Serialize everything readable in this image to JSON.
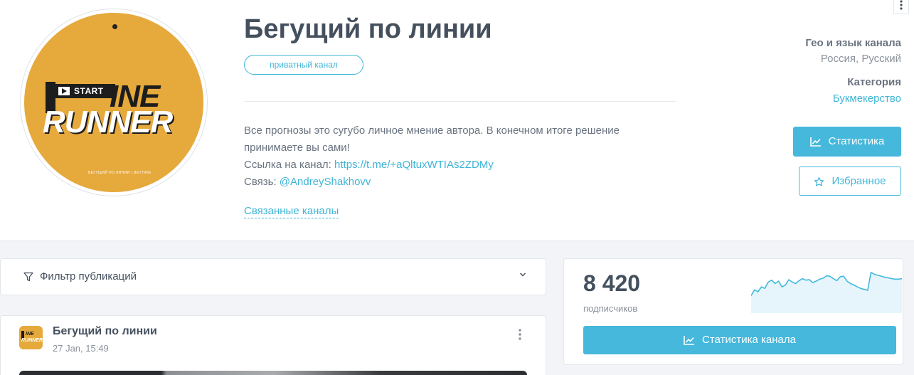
{
  "channel": {
    "title": "Бегущий по линии",
    "badge": "приватный канал",
    "description_lines": [
      "Все прогнозы это сугубо личное мнение автора. В конечном итоге решение",
      "принимаете вы сами!"
    ],
    "link_label": "Ссылка на канал: ",
    "link_url": "https://t.me/+aQltuxWTIAs2ZDMy",
    "contact_label": "Связь: ",
    "contact": "@AndreyShakhovv",
    "related_label": "Связанные каналы"
  },
  "logo": {
    "start": "START",
    "line": "INE",
    "runner": "RUNNER",
    "footer": "БЕГУЩИЙ ПО ЛИНИИ | BETTING"
  },
  "meta": {
    "geo_label": "Гео и язык канала",
    "geo_value": "Россия, Русский",
    "category_label": "Категория",
    "category_value": "Букмекерство"
  },
  "buttons": {
    "stats": "Статистика",
    "favorite": "Избранное",
    "channel_stats": "Статистика канала"
  },
  "filter": {
    "label": "Фильтр публикаций"
  },
  "post": {
    "author": "Бегущий по линии",
    "date": "27 Jan, 15:49"
  },
  "stats": {
    "subscribers": "8 420",
    "subscribers_label": "подписчиков",
    "sparkline": [
      30,
      42,
      38,
      48,
      45,
      58,
      62,
      55,
      60,
      48,
      52,
      63,
      58,
      55,
      61,
      65,
      62,
      63,
      57,
      60,
      64,
      66,
      71,
      70,
      65,
      61,
      69,
      70,
      60,
      55,
      52,
      48,
      45,
      43,
      41,
      78,
      74,
      72,
      70,
      68,
      67,
      65,
      64,
      64,
      65
    ]
  },
  "colors": {
    "accent": "#45b8dc",
    "brand": "#e6a93c",
    "text": "#45505e"
  }
}
